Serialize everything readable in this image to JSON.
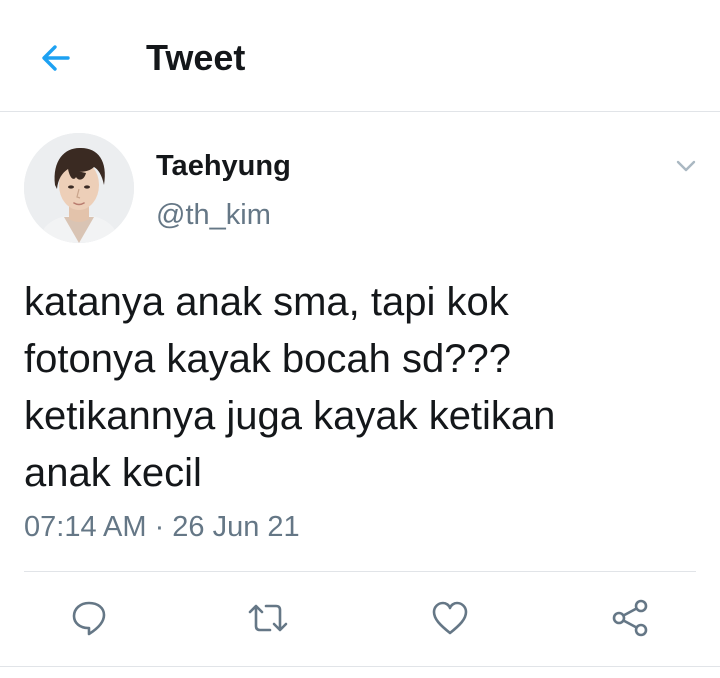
{
  "header": {
    "title": "Tweet",
    "back_icon": "arrow-left-icon",
    "accent_color": "#1da1f2"
  },
  "author": {
    "display_name": "Taehyung",
    "handle": "@th_kim",
    "avatar_icon": "avatar-photo"
  },
  "tweet": {
    "text": "katanya anak sma, tapi kok\nfotonya kayak bocah sd???\nketikannya juga kayak ketikan\nanak kecil",
    "timestamp": "07:14 AM · 26 Jun 21"
  },
  "actions": [
    {
      "name": "reply",
      "icon": "reply-icon"
    },
    {
      "name": "retweet",
      "icon": "retweet-icon"
    },
    {
      "name": "like",
      "icon": "heart-icon"
    },
    {
      "name": "share",
      "icon": "share-icon"
    }
  ],
  "colors": {
    "text_primary": "#14171a",
    "text_secondary": "#657786",
    "icon_gray": "#657786",
    "divider": "#e1e4e8"
  }
}
